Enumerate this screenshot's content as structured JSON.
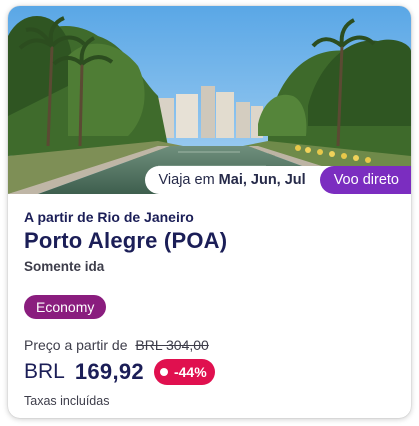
{
  "offer": {
    "travel_prefix": "Viaja em",
    "travel_months": "Mai, Jun, Jul",
    "direct_label": "Voo direto",
    "origin_line": "A partir de Rio de Janeiro",
    "destination": "Porto Alegre (POA)",
    "trip_type": "Somente ida",
    "cabin": "Economy",
    "price_from_label": "Preço a partir de",
    "old_price": "BRL  304,00",
    "currency": "BRL",
    "price": "169,92",
    "discount": "-44%",
    "taxes_note": "Taxas incluídas"
  },
  "colors": {
    "navy_text": "#1b1e57",
    "purple_chip": "#7b2dc0",
    "cabin_badge": "#8a1d7e",
    "discount_badge": "#e0104f"
  },
  "icons": {
    "discount_dot": "dot-icon"
  }
}
